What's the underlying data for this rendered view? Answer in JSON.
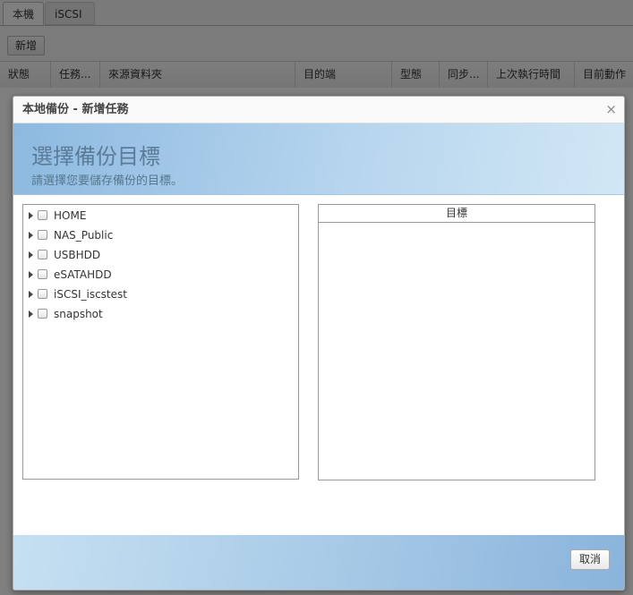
{
  "tabs": [
    {
      "label": "本機"
    },
    {
      "label": "iSCSI"
    }
  ],
  "toolbar": {
    "add_label": "新增"
  },
  "grid": {
    "columns": [
      "狀態",
      "任務...",
      "來源資料夾",
      "目的端",
      "型態",
      "同步...",
      "上次執行時間",
      "目前動作"
    ]
  },
  "dialog": {
    "title": "本地備份 - 新增任務",
    "close_glyph": "×",
    "banner_title": "選擇備份目標",
    "banner_subtitle": "請選擇您要儲存備份的目標。",
    "tree": [
      {
        "label": "HOME"
      },
      {
        "label": "NAS_Public"
      },
      {
        "label": "USBHDD"
      },
      {
        "label": "eSATAHDD"
      },
      {
        "label": "iSCSI_iscstest"
      },
      {
        "label": "snapshot"
      }
    ],
    "target_header": "目標",
    "cancel_label": "取消"
  },
  "colors": {
    "overlay": "rgba(0,0,0,0.5)",
    "banner_start": "#8db9e0",
    "banner_end": "#d2e7f5",
    "banner_text": "#5a7c98"
  }
}
